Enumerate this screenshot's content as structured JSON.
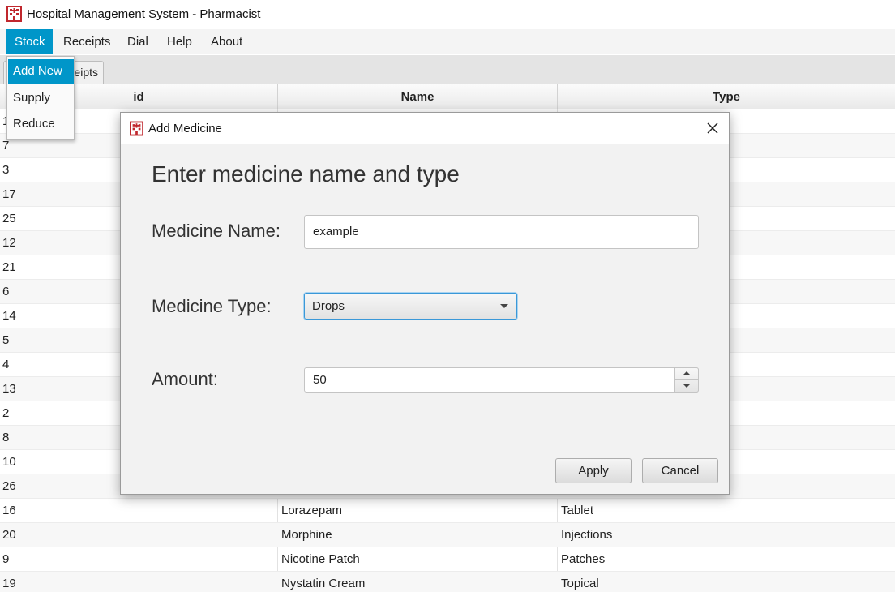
{
  "window": {
    "title": "Hospital Management System - Pharmacist",
    "icon": "hospital-icon"
  },
  "menubar": {
    "items": [
      {
        "label": "Stock"
      },
      {
        "label": "Receipts"
      },
      {
        "label": "Dial"
      },
      {
        "label": "Help"
      },
      {
        "label": "About"
      }
    ]
  },
  "stock_menu": {
    "items": [
      {
        "label": "Add New"
      },
      {
        "label": "Supply"
      },
      {
        "label": "Reduce"
      }
    ]
  },
  "tabs": {
    "receipts_label_visible": "eipts"
  },
  "table": {
    "columns": [
      "id",
      "Name",
      "Type"
    ],
    "rows": [
      {
        "id": "1",
        "name": "",
        "type": ""
      },
      {
        "id": "7",
        "name": "",
        "type": ""
      },
      {
        "id": "3",
        "name": "",
        "type": ""
      },
      {
        "id": "17",
        "name": "",
        "type": ""
      },
      {
        "id": "25",
        "name": "",
        "type": ""
      },
      {
        "id": "12",
        "name": "",
        "type": ""
      },
      {
        "id": "21",
        "name": "",
        "type": ""
      },
      {
        "id": "6",
        "name": "",
        "type": ""
      },
      {
        "id": "14",
        "name": "",
        "type": ""
      },
      {
        "id": "5",
        "name": "",
        "type": ""
      },
      {
        "id": "4",
        "name": "",
        "type": ""
      },
      {
        "id": "13",
        "name": "",
        "type": ""
      },
      {
        "id": "2",
        "name": "",
        "type": ""
      },
      {
        "id": "8",
        "name": "",
        "type": ""
      },
      {
        "id": "10",
        "name": "",
        "type": ""
      },
      {
        "id": "26",
        "name": "",
        "type": ""
      },
      {
        "id": "16",
        "name": "Lorazepam",
        "type": "Tablet"
      },
      {
        "id": "20",
        "name": "Morphine",
        "type": "Injections"
      },
      {
        "id": "9",
        "name": "Nicotine Patch",
        "type": "Patches"
      },
      {
        "id": "19",
        "name": "Nystatin Cream",
        "type": "Topical"
      }
    ]
  },
  "dialog": {
    "title": "Add Medicine",
    "heading": "Enter medicine name and type",
    "name_label": "Medicine Name:",
    "name_value": "example",
    "type_label": "Medicine Type:",
    "type_value": "Drops",
    "amount_label": "Amount:",
    "amount_value": "50",
    "apply_label": "Apply",
    "cancel_label": "Cancel"
  },
  "colors": {
    "accent": "#0096c9",
    "icon_red": "#c0272d"
  }
}
